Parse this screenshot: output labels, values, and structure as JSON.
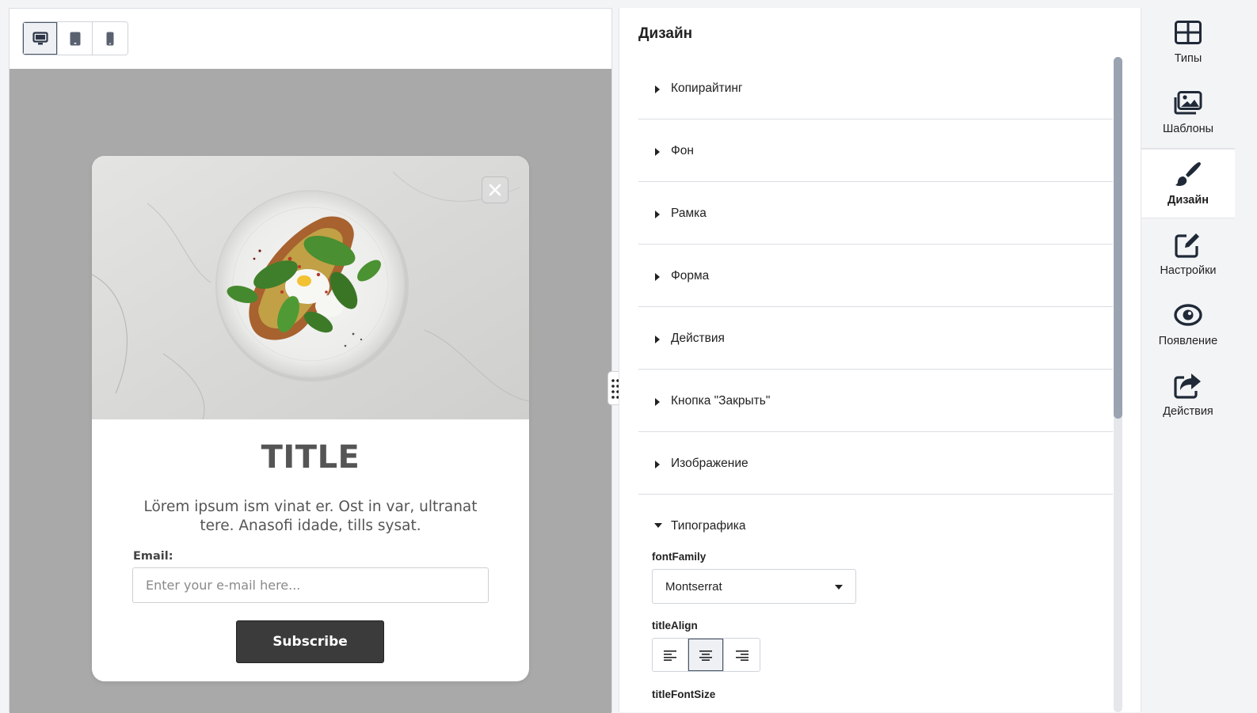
{
  "preview": {
    "device_buttons": [
      {
        "name": "desktop",
        "active": true
      },
      {
        "name": "tablet",
        "active": false
      },
      {
        "name": "mobile",
        "active": false
      }
    ],
    "popup": {
      "title": "TITLE",
      "description": "Lörem ipsum ism vinat er. Ost in var, ultranat tere. Anasofi idade, tills sysat.",
      "email_label": "Email:",
      "email_placeholder": "Enter your e-mail here...",
      "email_value": "",
      "subscribe_label": "Subscribe",
      "image_icon": "food-plate-image",
      "close_icon": "close-icon"
    },
    "background_color": "#a9a9a9",
    "button_color": "#3b3b3b"
  },
  "design_panel": {
    "title": "Дизайн",
    "sections": [
      {
        "label": "Копирайтинг",
        "open": false
      },
      {
        "label": "Фон",
        "open": false
      },
      {
        "label": "Рамка",
        "open": false
      },
      {
        "label": "Форма",
        "open": false
      },
      {
        "label": "Действия",
        "open": false
      },
      {
        "label": "Кнопка \"Закрыть\"",
        "open": false
      },
      {
        "label": "Изображение",
        "open": false
      },
      {
        "label": "Типографика",
        "open": true
      }
    ],
    "typography": {
      "font_family_label": "fontFamily",
      "font_family_value": "Montserrat",
      "title_align_label": "titleAlign",
      "title_align_options": [
        "left",
        "center",
        "right"
      ],
      "title_align_selected": "center",
      "title_font_size_label": "titleFontSize"
    }
  },
  "right_nav": {
    "items": [
      {
        "label": "Типы",
        "icon": "grid-icon",
        "active": false
      },
      {
        "label": "Шаблоны",
        "icon": "images-icon",
        "active": false
      },
      {
        "label": "Дизайн",
        "icon": "paintbrush-icon",
        "active": true
      },
      {
        "label": "Настройки",
        "icon": "edit-icon",
        "active": false
      },
      {
        "label": "Появление",
        "icon": "eye-icon",
        "active": false
      },
      {
        "label": "Действия",
        "icon": "share-icon",
        "active": false
      }
    ]
  }
}
